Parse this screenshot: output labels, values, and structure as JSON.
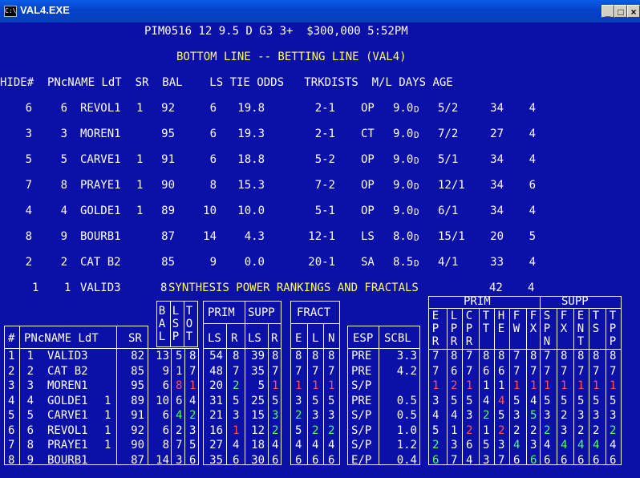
{
  "window": {
    "title": "VAL4.EXE",
    "icon": "C:\\",
    "buttons": [
      "_",
      "□",
      "×"
    ]
  },
  "header": {
    "race_line": "PIM0516 12 9.5 D G3 3+  $300,000 5:52PM",
    "title": "BOTTOM LINE -- BETTING LINE (VAL4)"
  },
  "betting_table": {
    "columns": "HIDE#  PNcNAME LdT  SR  BAL    LS TIE ODDS   TRKDISTS  M/L DAYS AGE",
    "rows": [
      {
        "hide": "6",
        "pn": "6",
        "name": "REVOL1",
        "ldt": "1",
        "sr": "92",
        "bal": "6",
        "ls": "19.8",
        "odds": "2-1",
        "trk": "OP",
        "dist": "9.0",
        "unit": "D",
        "ml": "5/2",
        "days": "34",
        "age": "4"
      },
      {
        "hide": "3",
        "pn": "3",
        "name": "MOREN1",
        "ldt": "",
        "sr": "95",
        "bal": "6",
        "ls": "19.3",
        "odds": "2-1",
        "trk": "CT",
        "dist": "9.0",
        "unit": "D",
        "ml": "7/2",
        "days": "27",
        "age": "4"
      },
      {
        "hide": "5",
        "pn": "5",
        "name": "CARVE1",
        "ldt": "1",
        "sr": "91",
        "bal": "6",
        "ls": "18.8",
        "odds": "5-2",
        "trk": "OP",
        "dist": "9.0",
        "unit": "D",
        "ml": "5/1",
        "days": "34",
        "age": "4"
      },
      {
        "hide": "7",
        "pn": "8",
        "name": "PRAYE1",
        "ldt": "1",
        "sr": "90",
        "bal": "8",
        "ls": "15.3",
        "odds": "7-2",
        "trk": "OP",
        "dist": "9.0",
        "unit": "D",
        "ml": "12/1",
        "days": "34",
        "age": "6"
      },
      {
        "hide": "4",
        "pn": "4",
        "name": "GOLDE1",
        "ldt": "1",
        "sr": "89",
        "bal": "10",
        "ls": "10.0",
        "odds": "5-1",
        "trk": "OP",
        "dist": "9.0",
        "unit": "D",
        "ml": "6/1",
        "days": "34",
        "age": "4"
      },
      {
        "hide": "8",
        "pn": "9",
        "name": "BOURB1",
        "ldt": "",
        "sr": "87",
        "bal": "14",
        "ls": "4.3",
        "odds": "12-1",
        "trk": "LS",
        "dist": "8.0",
        "unit": "D",
        "ml": "15/1",
        "days": "20",
        "age": "5"
      },
      {
        "hide": "2",
        "pn": "2",
        "name": "CAT B2",
        "ldt": "",
        "sr": "85",
        "bal": "9",
        "ls": "0.0",
        "odds": "20-1",
        "trk": "SA",
        "dist": "8.5",
        "unit": "D",
        "ml": "4/1",
        "days": "33",
        "age": "4"
      }
    ],
    "last_row": {
      "hide": "1",
      "pn": "1",
      "name": "VALID3",
      "ldt": "",
      "sr": "8",
      "overlay": "SYNTHESIS POWER RANKINGS AND FRACTALS",
      "days": "42",
      "age": "4"
    }
  },
  "synthesis": {
    "headers": {
      "num": "#",
      "name": "PNcNAME LdT",
      "sr": "SR",
      "bal": "BAL",
      "lsp": "LSP",
      "tot": "TOT",
      "prim": "PRIM",
      "supp": "SUPP",
      "ls": "LS",
      "r": "R",
      "fract": "FRACT",
      "e": "E",
      "l": "L",
      "n": "N",
      "esp": "ESP",
      "scbl": "SCBL"
    },
    "rows": [
      {
        "num": "1",
        "pn": "1",
        "name": "VALID3",
        "ldt": "",
        "sr": "82",
        "bal": "13",
        "lsp": "5",
        "tot": "8",
        "prim_ls": "54",
        "prim_r": "8",
        "supp_ls": "39",
        "supp_r": "8",
        "e": "8",
        "l": "8",
        "n": "8",
        "esp": "PRE",
        "scbl": "3.3"
      },
      {
        "num": "2",
        "pn": "2",
        "name": "CAT B2",
        "ldt": "",
        "sr": "85",
        "bal": "9",
        "lsp": "1",
        "tot": "7",
        "prim_ls": "48",
        "prim_r": "7",
        "supp_ls": "35",
        "supp_r": "7",
        "e": "7",
        "l": "7",
        "n": "7",
        "esp": "PRE",
        "scbl": "4.2"
      },
      {
        "num": "3",
        "pn": "3",
        "name": "MOREN1",
        "ldt": "",
        "sr": "95",
        "bal": "6",
        "lsp": "8",
        "tot": "1",
        "prim_ls": "20",
        "prim_r": "2",
        "supp_ls": "5",
        "supp_r": "1",
        "e": "1",
        "l": "1",
        "n": "1",
        "esp": "S/P",
        "scbl": ""
      },
      {
        "num": "4",
        "pn": "4",
        "name": "GOLDE1",
        "ldt": "1",
        "sr": "89",
        "bal": "10",
        "lsp": "6",
        "tot": "4",
        "prim_ls": "31",
        "prim_r": "5",
        "supp_ls": "25",
        "supp_r": "5",
        "e": "3",
        "l": "5",
        "n": "5",
        "esp": "PRE",
        "scbl": "0.5"
      },
      {
        "num": "5",
        "pn": "5",
        "name": "CARVE1",
        "ldt": "1",
        "sr": "91",
        "bal": "6",
        "lsp": "4",
        "tot": "2",
        "prim_ls": "21",
        "prim_r": "3",
        "supp_ls": "15",
        "supp_r": "3",
        "e": "2",
        "l": "3",
        "n": "3",
        "esp": "S/P",
        "scbl": "0.5"
      },
      {
        "num": "6",
        "pn": "6",
        "name": "REVOL1",
        "ldt": "1",
        "sr": "92",
        "bal": "6",
        "lsp": "2",
        "tot": "3",
        "prim_ls": "16",
        "prim_r": "1",
        "supp_ls": "12",
        "supp_r": "2",
        "e": "5",
        "l": "2",
        "n": "2",
        "esp": "S/P",
        "scbl": "1.0"
      },
      {
        "num": "7",
        "pn": "8",
        "name": "PRAYE1",
        "ldt": "1",
        "sr": "90",
        "bal": "8",
        "lsp": "7",
        "tot": "5",
        "prim_ls": "27",
        "prim_r": "4",
        "supp_ls": "18",
        "supp_r": "4",
        "e": "4",
        "l": "4",
        "n": "4",
        "esp": "S/P",
        "scbl": "1.2"
      },
      {
        "num": "8",
        "pn": "9",
        "name": "BOURB1",
        "ldt": "",
        "sr": "87",
        "bal": "14",
        "lsp": "3",
        "tot": "6",
        "prim_ls": "35",
        "prim_r": "6",
        "supp_ls": "30",
        "supp_r": "6",
        "e": "6",
        "l": "6",
        "n": "6",
        "esp": "E/P",
        "scbl": "0.4"
      }
    ],
    "right_headers": {
      "prim": "PRIM",
      "supp": "SUPP",
      "cols": [
        "EPR",
        "LPR",
        "CPR",
        "TT",
        "HE",
        "FW",
        "FX",
        "SPN",
        "FX",
        "ENT",
        "TS",
        "TPP"
      ]
    },
    "right_cols": [
      [
        "7",
        "7",
        "1",
        "3",
        "4",
        "5",
        "2",
        "6"
      ],
      [
        "8",
        "6",
        "2",
        "5",
        "4",
        "1",
        "3",
        "7"
      ],
      [
        "7",
        "7",
        "1",
        "5",
        "3",
        "2",
        "6",
        "4"
      ],
      [
        "8",
        "6",
        "1",
        "4",
        "2",
        "1",
        "5",
        "3"
      ],
      [
        "8",
        "6",
        "1",
        "4",
        "5",
        "2",
        "3",
        "7"
      ],
      [
        "7",
        "7",
        "1",
        "5",
        "3",
        "2",
        "4",
        "6"
      ],
      [
        "8",
        "7",
        "1",
        "4",
        "5",
        "2",
        "3",
        "6"
      ],
      [
        "7",
        "7",
        "1",
        "5",
        "3",
        "2",
        "4",
        "6"
      ],
      [
        "8",
        "7",
        "1",
        "5",
        "2",
        "3",
        "4",
        "6"
      ],
      [
        "8",
        "7",
        "1",
        "5",
        "3",
        "2",
        "4",
        "6"
      ],
      [
        "8",
        "7",
        "1",
        "5",
        "3",
        "2",
        "4",
        "6"
      ],
      [
        "8",
        "7",
        "1",
        "5",
        "3",
        "2",
        "4",
        "6"
      ]
    ],
    "colors": {
      "red": "#ff5555",
      "green": "#55ff55",
      "yellow": "#ffff55",
      "background": "#0a10a8"
    }
  }
}
